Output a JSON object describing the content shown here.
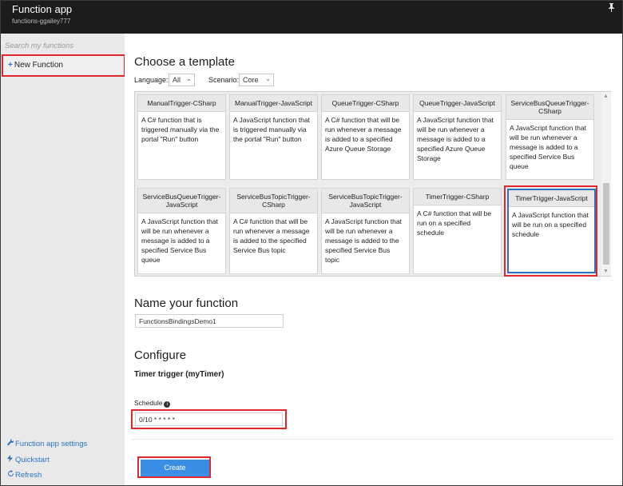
{
  "titlebar": {
    "title": "Function app",
    "subtitle": "functions-ggailey777",
    "pin_icon": "pin-icon"
  },
  "sidebar": {
    "search_placeholder": "Search my functions",
    "new_function": "New Function",
    "links": [
      {
        "label": "Function app settings",
        "icon": "wrench-icon"
      },
      {
        "label": "Quickstart",
        "icon": "lightning-icon"
      },
      {
        "label": "Refresh",
        "icon": "refresh-icon"
      }
    ]
  },
  "main": {
    "choose_template": "Choose a template",
    "language_label": "Language:",
    "language_value": "All",
    "scenario_label": "Scenario:",
    "scenario_value": "Core",
    "templates": [
      {
        "title": "ManualTrigger-CSharp",
        "desc": "A C# function that is triggered manually via the portal \"Run\" button"
      },
      {
        "title": "ManualTrigger-JavaScript",
        "desc": "A JavaScript function that is triggered manually via the portal \"Run\" button"
      },
      {
        "title": "QueueTrigger-CSharp",
        "desc": "A C# function that will be run whenever a message is added to a specified Azure Queue Storage"
      },
      {
        "title": "QueueTrigger-JavaScript",
        "desc": "A JavaScript function that will be run whenever a message is added to a specified Azure Queue Storage"
      },
      {
        "title": "ServiceBusQueueTrigger-CSharp",
        "desc": "A JavaScript function that will be run whenever a message is added to a specified Service Bus queue"
      },
      {
        "title": "ServiceBusQueueTrigger-JavaScript",
        "desc": "A JavaScript function that will be run whenever a message is added to a specified Service Bus queue"
      },
      {
        "title": "ServiceBusTopicTrigger-CSharp",
        "desc": "A C# function that will be run whenever a message is added to the specified Service Bus topic"
      },
      {
        "title": "ServiceBusTopicTrigger-JavaScript",
        "desc": "A JavaScript function that will be run whenever a message is added to the specified Service Bus topic"
      },
      {
        "title": "TimerTrigger-CSharp",
        "desc": "A C# function that will be run on a specified schedule"
      },
      {
        "title": "TimerTrigger-JavaScript",
        "desc": "A JavaScript function that will be run on a specified schedule"
      }
    ],
    "name_heading": "Name your function",
    "function_name": "FunctionsBindingsDemo1",
    "configure_heading": "Configure",
    "timer_trigger_label": "Timer trigger (myTimer)",
    "schedule_label": "Schedule",
    "schedule_value": "0/10 * * * * *",
    "create_label": "Create"
  }
}
